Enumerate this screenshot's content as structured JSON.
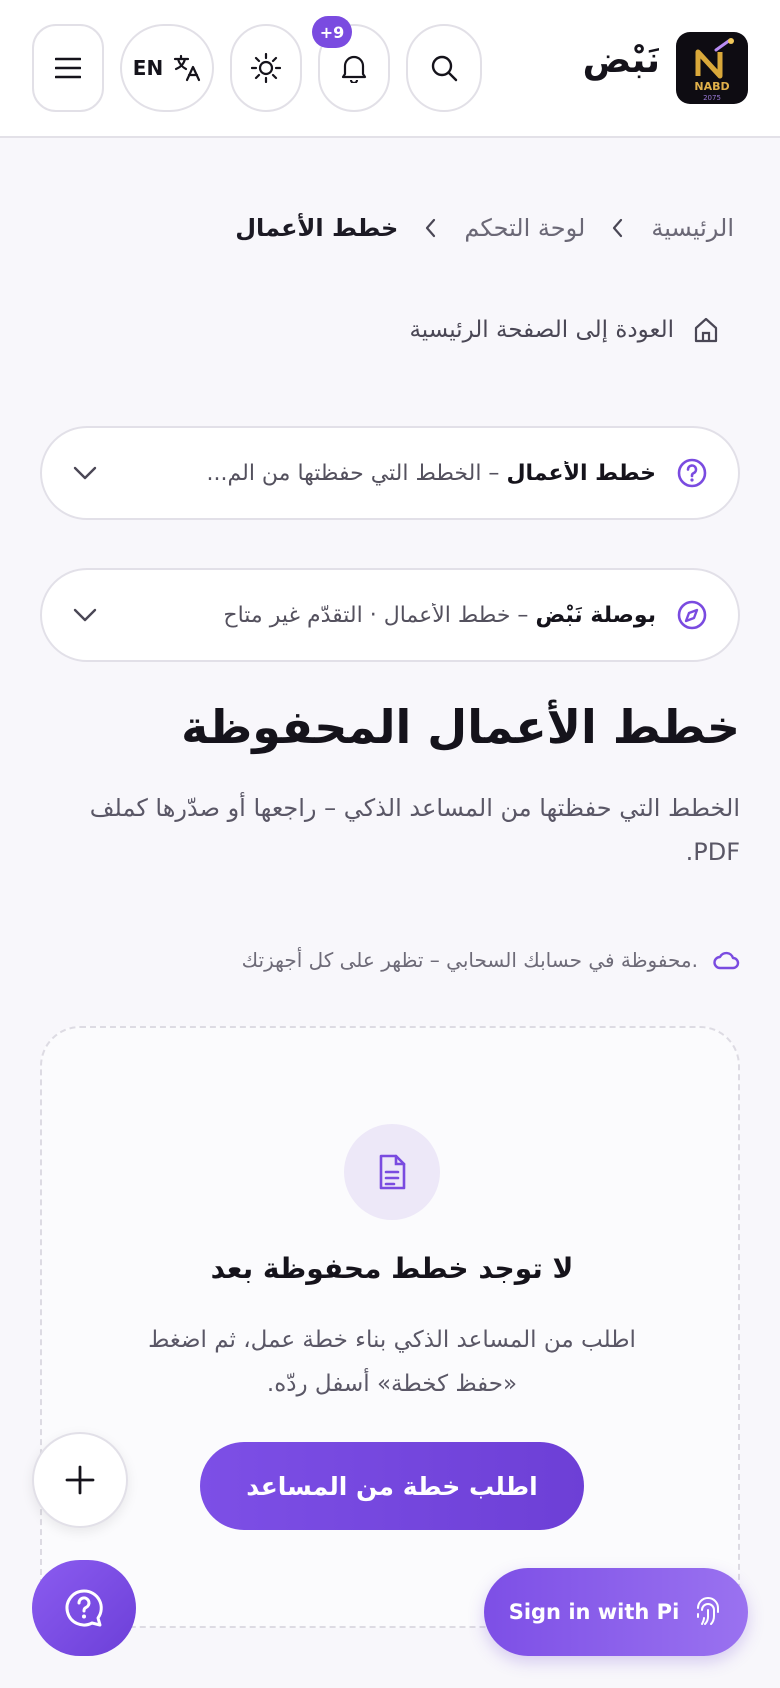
{
  "header": {
    "brand_name": "نَبْض",
    "logo_text": "NABD",
    "logo_year": "2075",
    "lang_label": "EN",
    "notification_badge": "+9"
  },
  "breadcrumb": {
    "home": "الرئيسية",
    "dashboard": "لوحة التحكم",
    "current": "خطط الأعمال"
  },
  "back_link": "العودة إلى الصفحة الرئيسية",
  "accordions": [
    {
      "title": "خطط الأعمال",
      "separator": " – ",
      "subtitle": "الخطط التي حفظتها من الم..."
    },
    {
      "title": "بوصلة نَبْض",
      "separator": " – ",
      "subtitle": "خطط الأعمال · التقدّم غير متاح"
    }
  ],
  "main": {
    "title": "خطط الأعمال المحفوظة",
    "description": "الخطط التي حفظتها من المساعد الذكي – راجعها أو صدّرها كملف PDF.",
    "cloud_note": "محفوظة في حسابك السحابي – تظهر على كل أجهزتك."
  },
  "empty_state": {
    "title": "لا توجد خطط محفوظة بعد",
    "description": "اطلب من المساعد الذكي بناء خطة عمل، ثم اضغط «حفظ كخطة» أسفل ردّه.",
    "cta_label": "اطلب خطة من المساعد"
  },
  "signin_label": "Sign in with Pi",
  "colors": {
    "accent": "#7a4be0",
    "background": "#f8f7fb"
  },
  "icons": {
    "menu": "menu-icon",
    "translate": "translate-icon",
    "theme": "sun-icon",
    "notifications": "bell-icon",
    "search": "search-icon",
    "home": "home-icon",
    "help": "help-circle-icon",
    "compass": "compass-icon",
    "chevron": "chevron-down-icon",
    "cloud": "cloud-icon",
    "document": "document-icon",
    "plus": "plus-icon",
    "fingerprint": "fingerprint-icon"
  }
}
